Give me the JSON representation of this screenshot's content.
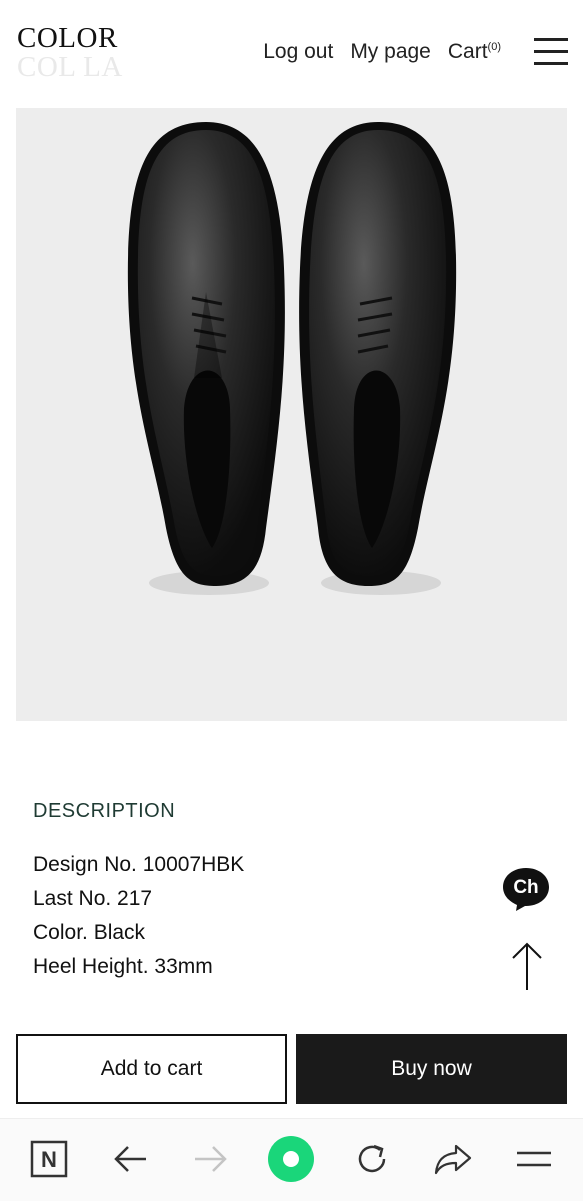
{
  "header": {
    "logo_line1": "COLOR",
    "logo_line2": "COL LA",
    "nav": {
      "logout": "Log out",
      "mypage": "My page",
      "cart_label": "Cart",
      "cart_count": "(0)"
    },
    "menu_icon": "hamburger-menu-icon"
  },
  "product": {
    "image_alt": "Black leather derby shoes, top view"
  },
  "description": {
    "title": "DESCRIPTION",
    "items": [
      "Design No. 10007HBK",
      "Last No. 217",
      "Color. Black",
      "Heel Height. 33mm"
    ]
  },
  "floating": {
    "chat_label": "Ch",
    "chat_icon": "chat-bubble-icon",
    "top_icon": "arrow-up-icon"
  },
  "actions": {
    "add_to_cart": "Add to cart",
    "buy_now": "Buy now"
  },
  "browser_bar": {
    "home_label": "N",
    "icons": [
      "naver-home-icon",
      "back-arrow-icon",
      "forward-arrow-icon",
      "green-dot-icon",
      "reload-icon",
      "share-icon",
      "menu-icon"
    ]
  },
  "colors": {
    "accent_green": "#1ad67a",
    "description_title": "#1f3b33",
    "buy_button_bg": "#1a1a1a",
    "image_bg": "#ededed"
  }
}
